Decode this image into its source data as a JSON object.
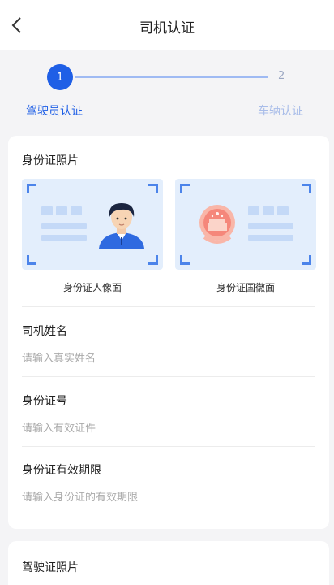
{
  "header": {
    "title": "司机认证",
    "back_icon": "chevron-left-icon"
  },
  "stepper": {
    "current_step": 1,
    "steps": [
      {
        "number": "1",
        "label": "驾驶员认证",
        "state": "active",
        "color": "#1f5fe6"
      },
      {
        "number": "2",
        "label": "车辆认证",
        "state": "inactive",
        "color": "#a9bde9"
      }
    ]
  },
  "id_photos": {
    "title": "身份证照片",
    "front": {
      "caption": "身份证人像面",
      "icon": "portrait-avatar-icon"
    },
    "back": {
      "caption": "身份证国徽面",
      "icon": "national-emblem-icon"
    }
  },
  "fields": [
    {
      "label": "司机姓名",
      "placeholder": "请输入真实姓名",
      "value": ""
    },
    {
      "label": "身份证号",
      "placeholder": "请输入有效证件",
      "value": ""
    },
    {
      "label": "身份证有效期限",
      "placeholder": "请输入身份证的有效期限",
      "value": ""
    }
  ],
  "license_section": {
    "title": "驾驶证照片"
  },
  "colors": {
    "accent": "#1f5fe6",
    "background": "#f4f4f6",
    "card": "#ffffff",
    "placeholder": "#aaaaaa"
  }
}
